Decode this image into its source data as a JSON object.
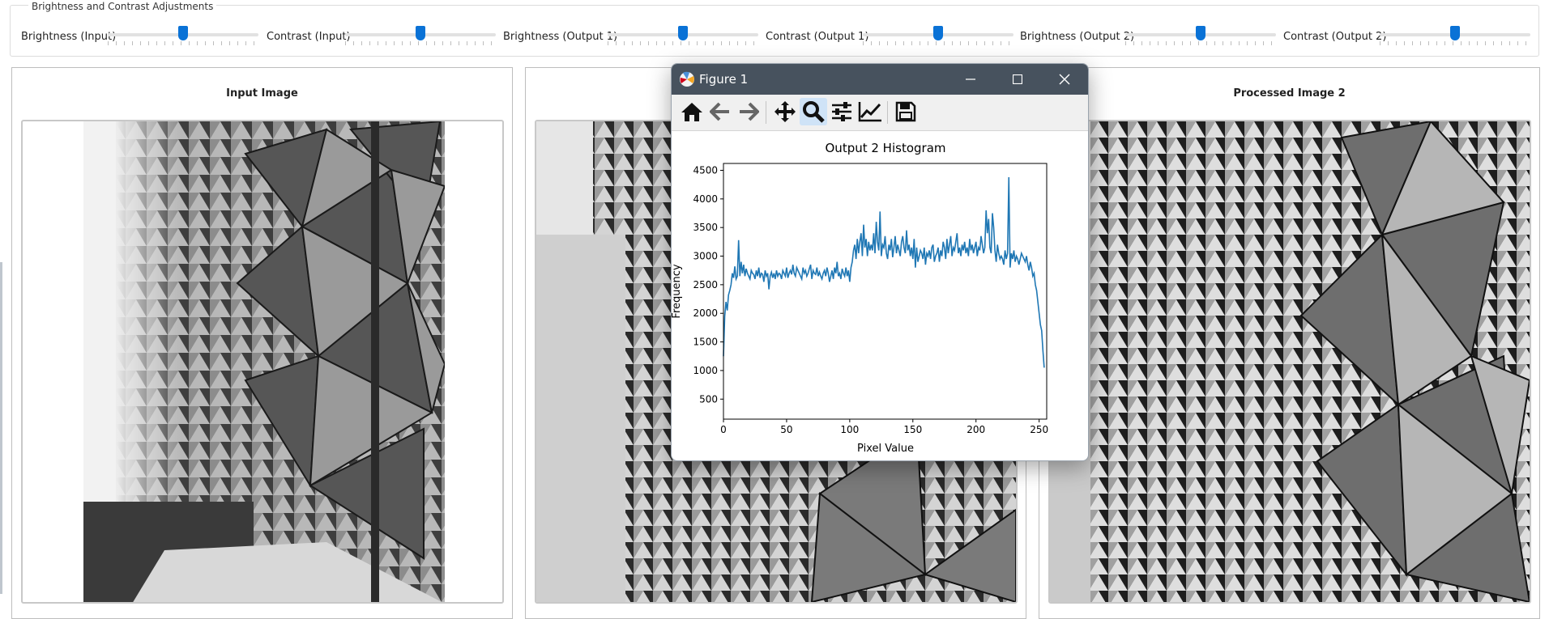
{
  "controls": {
    "group_title": "Brightness and Contrast Adjustments",
    "sliders": [
      {
        "label": "Brightness (Input)",
        "value": 0.5
      },
      {
        "label": "Contrast (Input)",
        "value": 0.5
      },
      {
        "label": "Brightness (Output 1)",
        "value": 0.5
      },
      {
        "label": "Contrast (Output 1)",
        "value": 0.5
      },
      {
        "label": "Brightness (Output 2)",
        "value": 0.5
      },
      {
        "label": "Contrast (Output 2)",
        "value": 0.5
      }
    ]
  },
  "panels": {
    "input": {
      "title": "Input Image"
    },
    "output1": {
      "title": ""
    },
    "output2": {
      "title": "Processed Image 2"
    }
  },
  "figure_window": {
    "title": "Figure 1",
    "toolbar": [
      "home-icon",
      "back-arrow-icon",
      "forward-arrow-icon",
      "pan-icon",
      "zoom-icon",
      "configure-subplots-icon",
      "edit-axis-icon",
      "save-icon"
    ],
    "active_tool": "zoom-icon"
  },
  "colors": {
    "accent": "#0a72d6",
    "titlebar": "#47525e",
    "line": "#1f77b4",
    "toolbar_active": "#cfe3f7"
  },
  "chart_data": {
    "type": "line",
    "title": "Output 2 Histogram",
    "xlabel": "Pixel Value",
    "ylabel": "Frequency",
    "xlim": [
      0,
      256
    ],
    "ylim": [
      150,
      4620
    ],
    "xticks": [
      0,
      50,
      100,
      150,
      200,
      250
    ],
    "yticks": [
      500,
      1000,
      1500,
      2000,
      2500,
      3000,
      3500,
      4000,
      4500
    ],
    "grid": false,
    "series": [
      {
        "values": [
          1250,
          1950,
          2200,
          2050,
          2320,
          2400,
          2500,
          2700,
          2620,
          2820,
          2600,
          2650,
          3280,
          2650,
          2900,
          2700,
          2850,
          2650,
          2780,
          2700,
          2650,
          2600,
          2750,
          2700,
          2680,
          2600,
          2750,
          2650,
          2800,
          2620,
          2700,
          2680,
          2550,
          2750,
          2650,
          2700,
          2420,
          2650,
          2720,
          2620,
          2700,
          2600,
          2750,
          2650,
          2700,
          2680,
          2600,
          2750,
          2700,
          2650,
          2800,
          2620,
          2700,
          2750,
          2680,
          2850,
          2700,
          2650,
          2800,
          2750,
          2700,
          2650,
          2600,
          2800,
          2700,
          2750,
          2650,
          2700,
          2780,
          2850,
          2600,
          2750,
          2700,
          2680,
          2800,
          2650,
          2720,
          2650,
          2600,
          2700,
          2750,
          2650,
          2800,
          2700,
          2550,
          2650,
          2750,
          2600,
          2800,
          2700,
          2900,
          2650,
          2700,
          2600,
          2780,
          2700,
          2650,
          2800,
          2650,
          2750,
          2550,
          2800,
          2900,
          3100,
          3200,
          2950,
          3300,
          3050,
          3250,
          3400,
          3000,
          3550,
          3150,
          3300,
          3000,
          3250,
          3100,
          3200,
          3100,
          3400,
          3050,
          3600,
          3250,
          3100,
          3780,
          3000,
          3200,
          3150,
          3350,
          3050,
          2950,
          3200,
          3100,
          3300,
          2980,
          3150,
          3350,
          3050,
          3200,
          3100,
          3000,
          3250,
          3350,
          3150,
          3050,
          3450,
          3100,
          3200,
          3000,
          3150,
          2950,
          3300,
          2800,
          3150,
          2900,
          3000,
          3100,
          3050,
          2950,
          3150,
          2850,
          3050,
          3000,
          3100,
          2950,
          3150,
          3200,
          2900,
          3000,
          3050,
          3150,
          2900,
          3100,
          3000,
          3250,
          3150,
          2950,
          3300,
          3050,
          3200,
          3350,
          3000,
          3150,
          3100,
          3250,
          3400,
          3050,
          3150,
          3000,
          3200,
          3100,
          3250,
          3050,
          3150,
          3000,
          3300,
          3100,
          3200,
          3050,
          3150,
          3250,
          3000,
          3150,
          3100,
          3350,
          3200,
          3050,
          3150,
          3800,
          3400,
          3650,
          3150,
          3050,
          3750,
          3500,
          3100,
          2900,
          3200,
          3050,
          2950,
          3000,
          2950,
          2850,
          3100,
          2950,
          3050,
          4380,
          2800,
          3050,
          2950,
          3100,
          2900,
          3000,
          2950,
          2850,
          2950,
          3050,
          3000,
          2950,
          2900,
          3000,
          2850,
          2750,
          2900,
          2800,
          2650,
          2700,
          2500,
          2400,
          2200,
          2000,
          1800,
          1700,
          1350,
          1050
        ]
      }
    ]
  }
}
